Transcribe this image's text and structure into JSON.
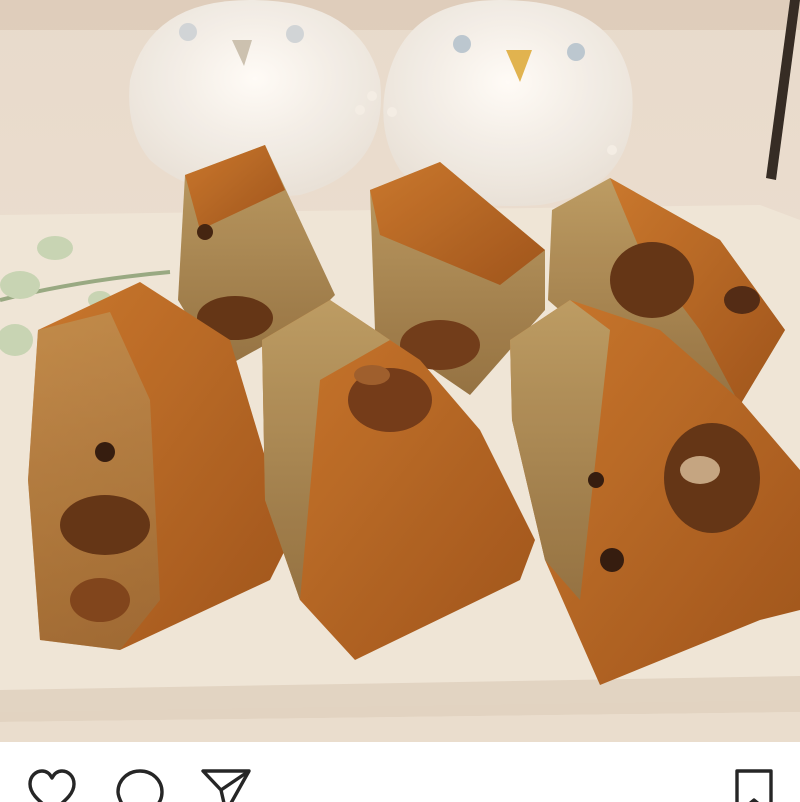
{
  "post": {
    "photo": {
      "subject": "sliced-pound-cake-on-white-plate"
    },
    "actions": {
      "like_icon": "heart-icon",
      "comment_icon": "comment-bubble-icon",
      "share_icon": "paper-plane-icon",
      "save_icon": "bookmark-icon"
    }
  },
  "colors": {
    "background": "#ffffff",
    "icon_stroke": "#262626",
    "cake_crust": "#b5621f",
    "cake_crumb": "#a98a58",
    "plate": "#efe8de"
  }
}
